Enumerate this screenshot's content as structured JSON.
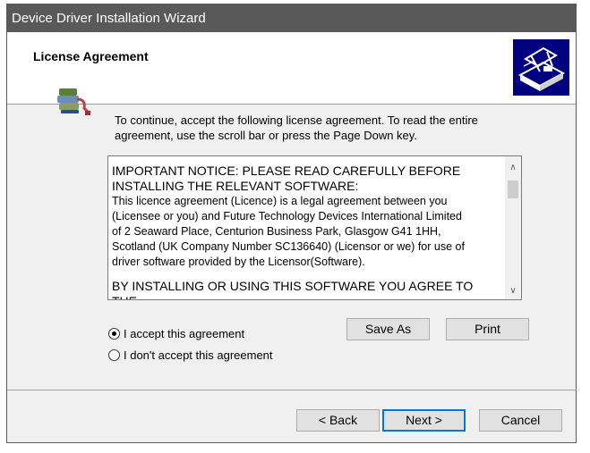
{
  "window": {
    "title": "Device Driver Installation Wizard"
  },
  "header": {
    "title": "License Agreement",
    "logo_icon": "hardware-drive-icon"
  },
  "instruction": "To continue, accept the following license agreement. To read the entire agreement, use the scroll bar or press the Page Down key.",
  "license": {
    "heading_line1": "IMPORTANT NOTICE: PLEASE READ CAREFULLY BEFORE",
    "heading_line2": "INSTALLING THE RELEVANT SOFTWARE:",
    "para_line1": "This licence agreement (Licence) is a legal agreement between you",
    "para_line2": "(Licensee or you) and Future Technology Devices International Limited",
    "para_line3": "of 2 Seaward Place, Centurion Business Park, Glasgow G41 1HH,",
    "para_line4": "Scotland (UK Company Number SC136640) (Licensor or we) for use of",
    "para_line5": "driver software provided by the Licensor(Software).",
    "para2_line1": "BY INSTALLING OR USING THIS SOFTWARE YOU AGREE TO THE"
  },
  "options": {
    "accept": "I accept this agreement",
    "decline": "I don't accept this agreement",
    "selected": "accept"
  },
  "buttons": {
    "save_as": "Save As",
    "print": "Print",
    "back": "< Back",
    "next": "Next >",
    "cancel": "Cancel"
  },
  "colors": {
    "titlebar": "#595959",
    "logo_bg": "#000080",
    "focus": "#0078d7"
  }
}
